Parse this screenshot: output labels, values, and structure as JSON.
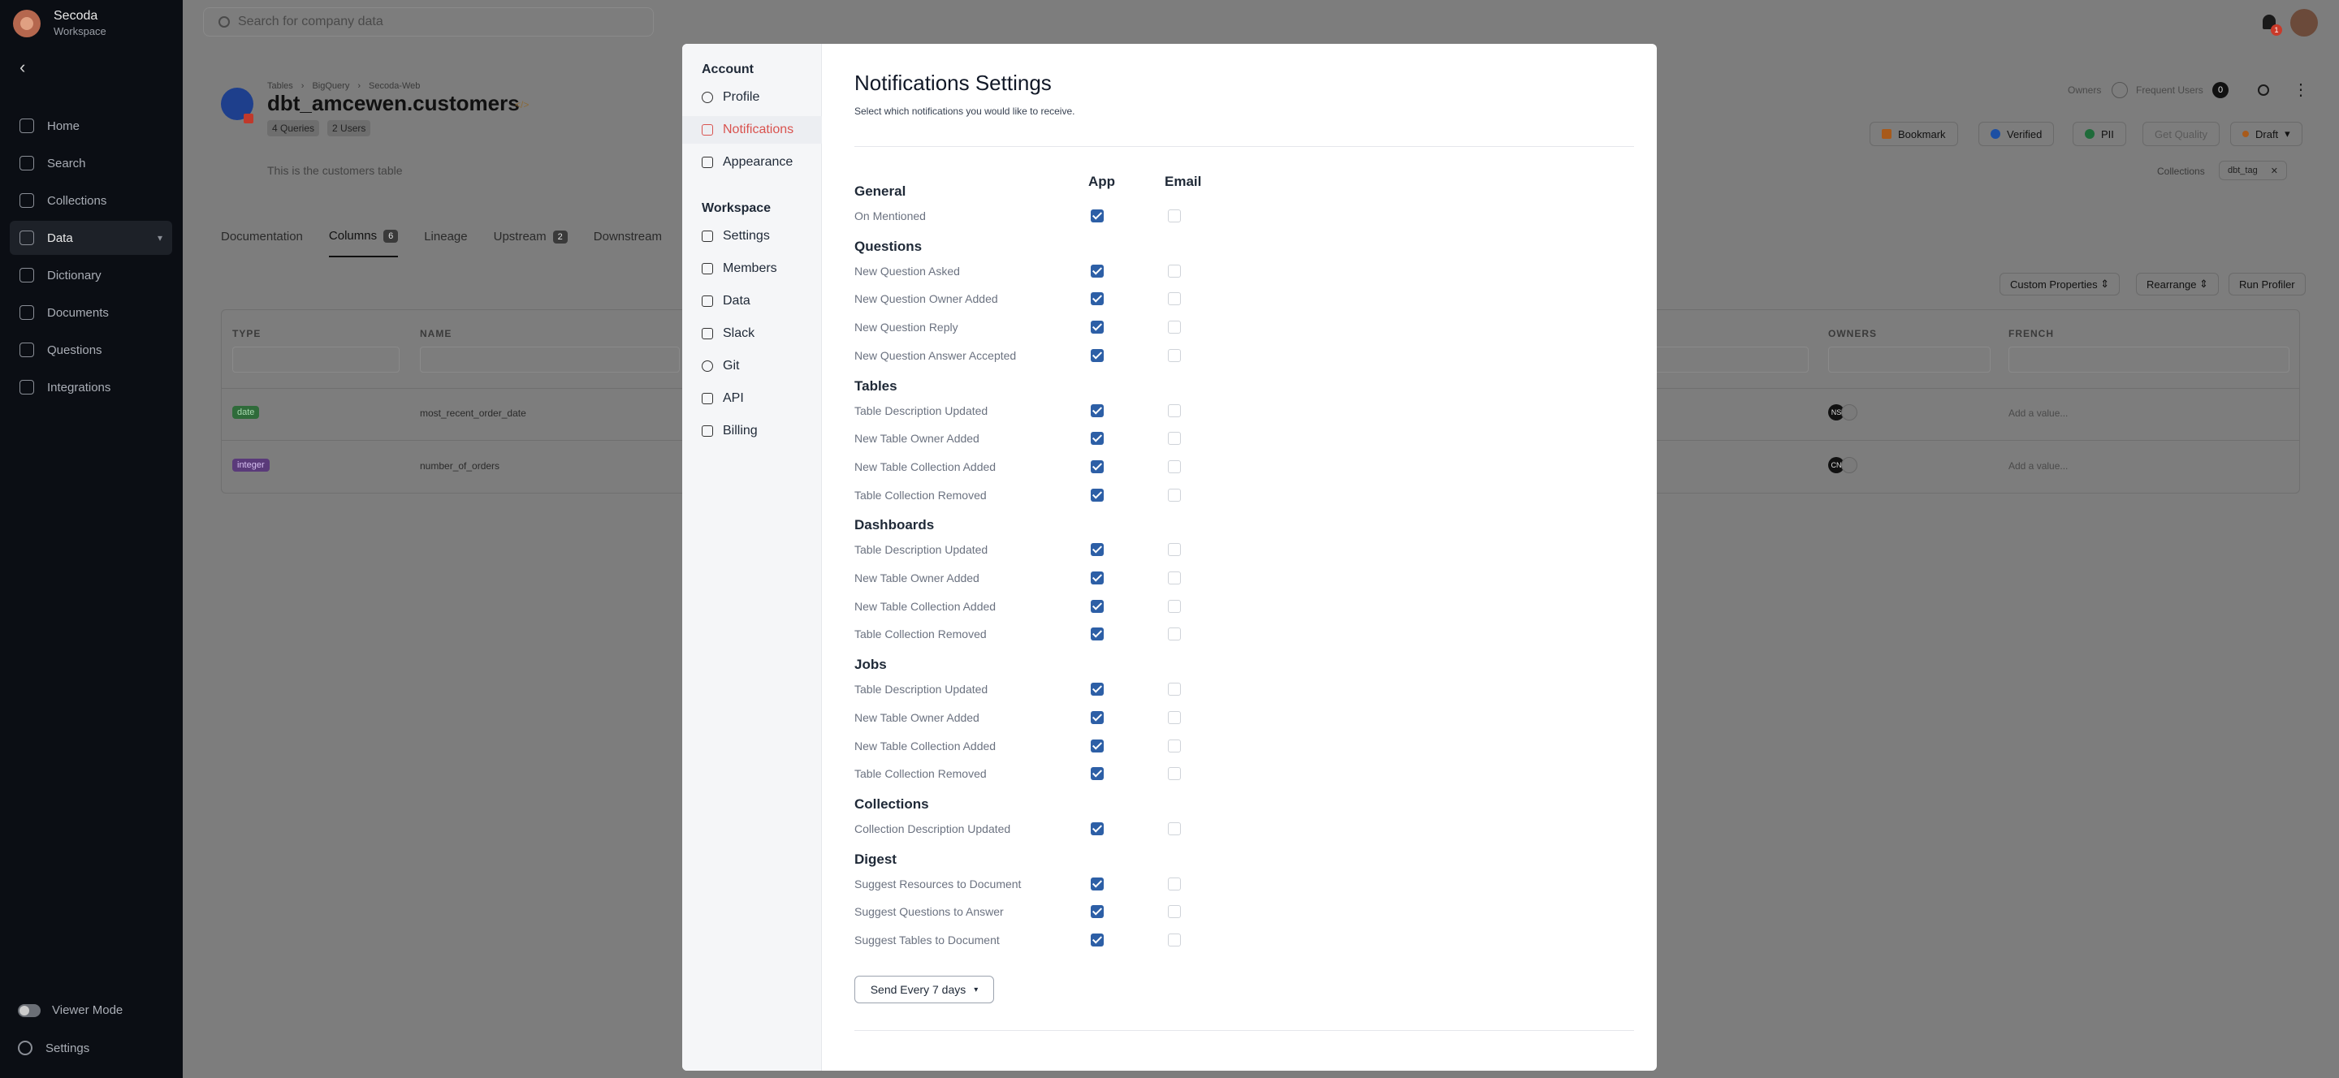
{
  "sidebar": {
    "workspace_name": "Secoda",
    "workspace_sub": "Workspace",
    "items": [
      {
        "label": "Home"
      },
      {
        "label": "Search"
      },
      {
        "label": "Collections"
      },
      {
        "label": "Data"
      },
      {
        "label": "Dictionary"
      },
      {
        "label": "Documents"
      },
      {
        "label": "Questions"
      },
      {
        "label": "Integrations"
      }
    ],
    "viewer_mode": "Viewer Mode",
    "settings": "Settings"
  },
  "topbar": {
    "search_placeholder": "Search for company data",
    "notif_count": "1"
  },
  "page": {
    "breadcrumbs": [
      "Tables",
      "BigQuery",
      "Secoda-Web"
    ],
    "title": "dbt_amcewen.customers",
    "title_code": "</>",
    "chips": [
      "4 Queries",
      "2 Users"
    ],
    "description": "This is the customers table",
    "owners_label": "Owners",
    "frequent_users_label": "Frequent Users",
    "frequent_users_count": "0",
    "actions": [
      "Bookmark",
      "Verified",
      "PII",
      "Get Quality",
      "Draft"
    ],
    "collections_label": "Collections",
    "collection_tag": "dbt_tag",
    "tabs": [
      {
        "label": "Documentation",
        "count": ""
      },
      {
        "label": "Columns",
        "count": "6"
      },
      {
        "label": "Lineage",
        "count": ""
      },
      {
        "label": "Upstream",
        "count": "2"
      },
      {
        "label": "Downstream",
        "count": ""
      }
    ],
    "table_buttons": [
      "Custom Properties",
      "Rearrange",
      "Run Profiler"
    ],
    "table_headers": {
      "type": "TYPE",
      "name": "NAME",
      "owners": "OWNERS",
      "french": "FRENCH"
    },
    "rows": [
      {
        "type": "date",
        "name": "most_recent_order_date",
        "owner": "NS",
        "french": "Add a value..."
      },
      {
        "type": "integer",
        "name": "number_of_orders",
        "owner": "CN",
        "french": "Add a value..."
      }
    ]
  },
  "modal": {
    "account_label": "Account",
    "account_items": [
      "Profile",
      "Notifications",
      "Appearance"
    ],
    "workspace_label": "Workspace",
    "workspace_items": [
      "Settings",
      "Members",
      "Data",
      "Slack",
      "Git",
      "API",
      "Billing"
    ],
    "title": "Notifications Settings",
    "subtitle": "Select which notifications you would like to receive.",
    "col_app": "App",
    "col_email": "Email",
    "sections": [
      {
        "title": "General",
        "rows": [
          {
            "label": "On Mentioned",
            "app": true,
            "email": false
          }
        ]
      },
      {
        "title": "Questions",
        "rows": [
          {
            "label": "New Question Asked",
            "app": true,
            "email": false
          },
          {
            "label": "New Question Owner Added",
            "app": true,
            "email": false
          },
          {
            "label": "New Question Reply",
            "app": true,
            "email": false
          },
          {
            "label": "New Question Answer Accepted",
            "app": true,
            "email": false
          }
        ]
      },
      {
        "title": "Tables",
        "rows": [
          {
            "label": "Table Description Updated",
            "app": true,
            "email": false
          },
          {
            "label": "New Table Owner Added",
            "app": true,
            "email": false
          },
          {
            "label": "New Table Collection Added",
            "app": true,
            "email": false
          },
          {
            "label": "Table Collection Removed",
            "app": true,
            "email": false
          }
        ]
      },
      {
        "title": "Dashboards",
        "rows": [
          {
            "label": "Table Description Updated",
            "app": true,
            "email": false
          },
          {
            "label": "New Table Owner Added",
            "app": true,
            "email": false
          },
          {
            "label": "New Table Collection Added",
            "app": true,
            "email": false
          },
          {
            "label": "Table Collection Removed",
            "app": true,
            "email": false
          }
        ]
      },
      {
        "title": "Jobs",
        "rows": [
          {
            "label": "Table Description Updated",
            "app": true,
            "email": false
          },
          {
            "label": "New Table Owner Added",
            "app": true,
            "email": false
          },
          {
            "label": "New Table Collection Added",
            "app": true,
            "email": false
          },
          {
            "label": "Table Collection Removed",
            "app": true,
            "email": false
          }
        ]
      },
      {
        "title": "Collections",
        "rows": [
          {
            "label": "Collection Description Updated",
            "app": true,
            "email": false
          }
        ]
      },
      {
        "title": "Digest",
        "rows": [
          {
            "label": "Suggest Resources to Document",
            "app": true,
            "email": false
          },
          {
            "label": "Suggest Questions to Answer",
            "app": true,
            "email": false
          },
          {
            "label": "Suggest Tables to Document",
            "app": true,
            "email": false
          }
        ]
      }
    ],
    "digest_frequency": "Send Every 7 days",
    "accent_color": "#2d5fa6",
    "active_color": "#d9534f"
  }
}
